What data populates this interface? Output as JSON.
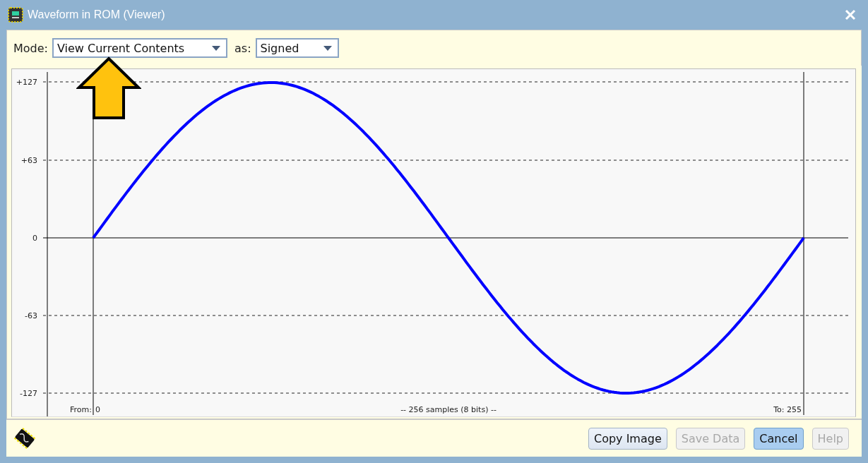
{
  "window": {
    "title": "Waveform in ROM (Viewer)"
  },
  "toolbar": {
    "mode": {
      "label": "Mode:",
      "value": "View Current Contents"
    },
    "format": {
      "label": "as:",
      "value": "Signed"
    }
  },
  "plot": {
    "y_labels": [
      "+127",
      "+63",
      "0",
      "-63",
      "-127"
    ],
    "from_label": "From:",
    "from_value": "0",
    "samples_label": "-- 256 samples (8 bits) --",
    "to_label": "To: 255"
  },
  "buttons": [
    {
      "label": "Copy Image",
      "disabled": false,
      "default": false
    },
    {
      "label": "Save Data",
      "disabled": true,
      "default": false
    },
    {
      "label": "Cancel",
      "disabled": false,
      "default": true
    },
    {
      "label": "Help",
      "disabled": true,
      "default": false
    }
  ]
}
